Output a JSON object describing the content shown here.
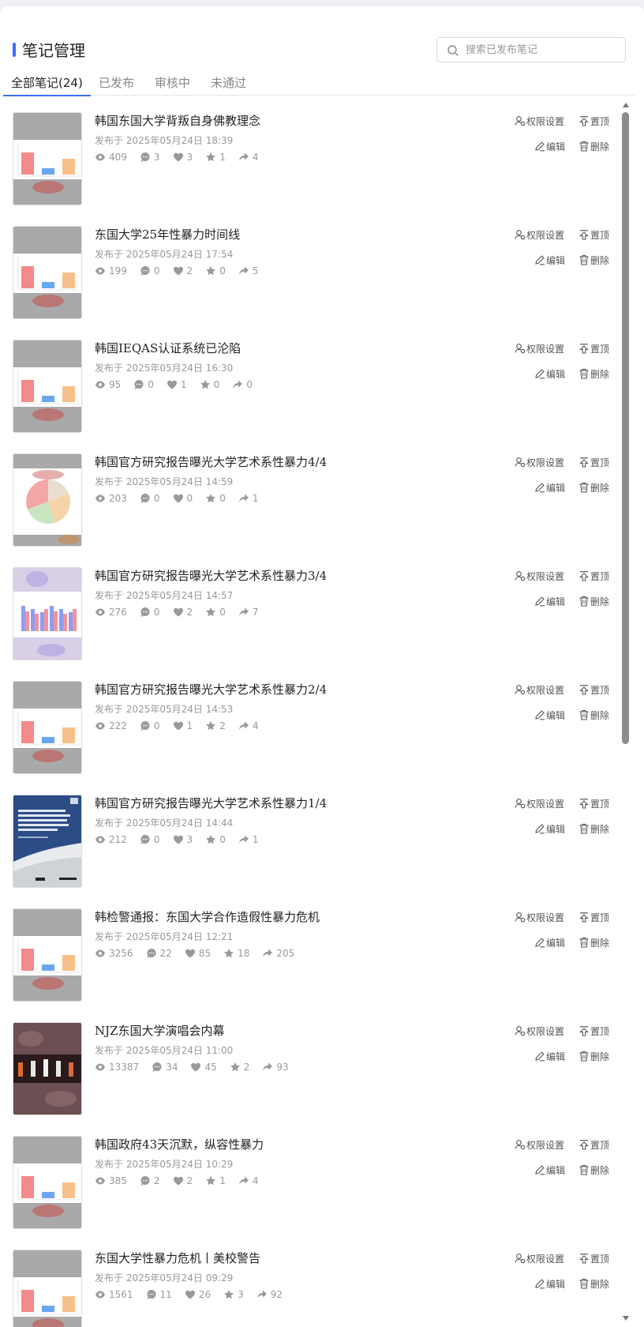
{
  "page": {
    "title": "笔记管理",
    "search_placeholder": "搜索已发布笔记"
  },
  "tabs": [
    {
      "label": "全部笔记(24)",
      "active": true
    },
    {
      "label": "已发布",
      "active": false
    },
    {
      "label": "审核中",
      "active": false
    },
    {
      "label": "未通过",
      "active": false
    }
  ],
  "actions": {
    "permission": "权限设置",
    "pin": "置顶",
    "edit": "编辑",
    "delete": "删除"
  },
  "notes": [
    {
      "title": "韩国东国大学背叛自身佛教理念",
      "date": "发布于 2025年05月24日 18:39",
      "views": "409",
      "comments": "3",
      "likes": "3",
      "favorites": "1",
      "shares": "4",
      "thumb": "bar"
    },
    {
      "title": "东国大学25年性暴力时间线",
      "date": "发布于 2025年05月24日 17:54",
      "views": "199",
      "comments": "0",
      "likes": "2",
      "favorites": "0",
      "shares": "5",
      "thumb": "bar"
    },
    {
      "title": "韩国IEQAS认证系统已沦陷",
      "date": "发布于 2025年05月24日 16:30",
      "views": "95",
      "comments": "0",
      "likes": "1",
      "favorites": "0",
      "shares": "0",
      "thumb": "bar"
    },
    {
      "title": "韩国官方研究报告曝光大学艺术系性暴力4/4",
      "date": "发布于 2025年05月24日 14:59",
      "views": "203",
      "comments": "0",
      "likes": "0",
      "favorites": "0",
      "shares": "1",
      "thumb": "pie"
    },
    {
      "title": "韩国官方研究报告曝光大学艺术系性暴力3/4",
      "date": "发布于 2025年05月24日 14:57",
      "views": "276",
      "comments": "0",
      "likes": "2",
      "favorites": "0",
      "shares": "7",
      "thumb": "grouped"
    },
    {
      "title": "韩国官方研究报告曝光大学艺术系性暴力2/4",
      "date": "发布于 2025年05月24日 14:53",
      "views": "222",
      "comments": "0",
      "likes": "1",
      "favorites": "2",
      "shares": "4",
      "thumb": "bar"
    },
    {
      "title": "韩国官方研究报告曝光大学艺术系性暴力1/4",
      "date": "发布于 2025年05月24日 14:44",
      "views": "212",
      "comments": "0",
      "likes": "3",
      "favorites": "0",
      "shares": "1",
      "thumb": "cover"
    },
    {
      "title": "韩检警通报：东国大学合作造假性暴力危机",
      "date": "发布于 2025年05月24日 12:21",
      "views": "3256",
      "comments": "22",
      "likes": "85",
      "favorites": "18",
      "shares": "205",
      "thumb": "bar"
    },
    {
      "title": "NJZ东国大学演唱会内幕",
      "date": "发布于 2025年05月24日 11:00",
      "views": "13387",
      "comments": "34",
      "likes": "45",
      "favorites": "2",
      "shares": "93",
      "thumb": "photo"
    },
    {
      "title": "韩国政府43天沉默，纵容性暴力",
      "date": "发布于 2025年05月24日 10:29",
      "views": "385",
      "comments": "2",
      "likes": "2",
      "favorites": "1",
      "shares": "4",
      "thumb": "bar"
    },
    {
      "title": "东国大学性暴力危机丨美校警告",
      "date": "发布于 2025年05月24日 09:29",
      "views": "1561",
      "comments": "11",
      "likes": "26",
      "favorites": "3",
      "shares": "92",
      "thumb": "bar"
    }
  ],
  "cover_text": {
    "heading": "Current Status of Sexual Violence Against University Students in the Culture and Arts after the Me Too Movement and Policy Issues"
  },
  "colors": {
    "accent": "#3e6dfa",
    "bar_red": "#f48a8a",
    "bar_blue": "#6aa6f2",
    "bar_orange": "#f7c08a",
    "cover_bg": "#2c4c86"
  }
}
